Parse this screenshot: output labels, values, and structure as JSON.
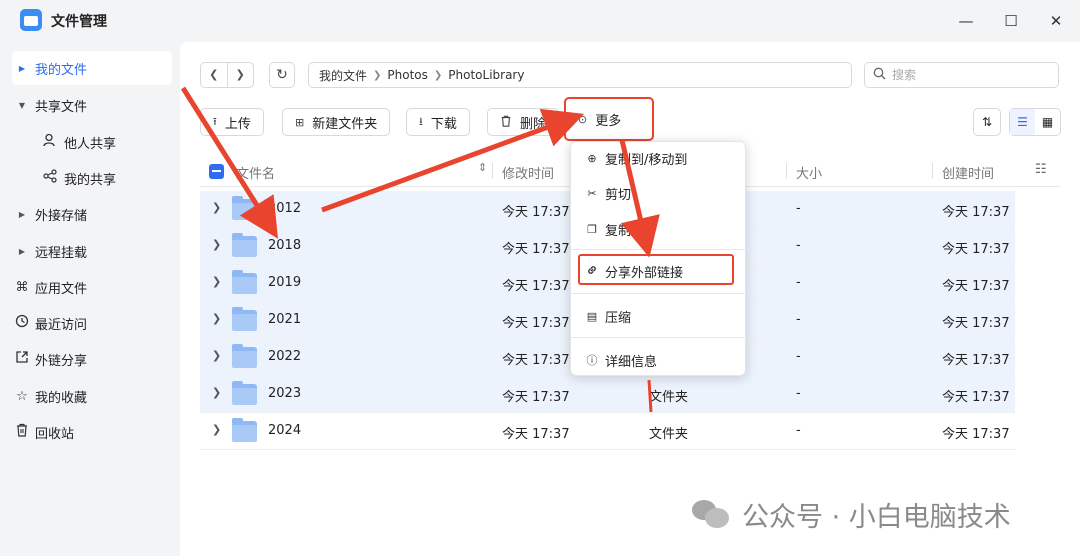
{
  "app": {
    "title": "文件管理",
    "window_controls": {
      "minimize": "—",
      "maximize": "☐",
      "close": "✕"
    }
  },
  "sidebar": {
    "items": [
      {
        "label": "我的文件",
        "icon": "caret-right-icon",
        "active": true
      },
      {
        "label": "共享文件",
        "icon": "caret-down-icon"
      },
      {
        "label": "他人共享",
        "icon": "user-icon",
        "sub": true
      },
      {
        "label": "我的共享",
        "icon": "share-icon",
        "sub": true
      },
      {
        "label": "外接存储",
        "icon": "caret-right-icon"
      },
      {
        "label": "远程挂载",
        "icon": "caret-right-icon"
      },
      {
        "label": "应用文件",
        "icon": "command-icon"
      },
      {
        "label": "最近访问",
        "icon": "clock-icon"
      },
      {
        "label": "外链分享",
        "icon": "external-link-icon"
      },
      {
        "label": "我的收藏",
        "icon": "star-icon"
      },
      {
        "label": "回收站",
        "icon": "trash-icon"
      }
    ]
  },
  "breadcrumb": [
    "我的文件",
    "Photos",
    "PhotoLibrary"
  ],
  "search": {
    "placeholder": "搜索"
  },
  "toolbar": {
    "upload": "上传",
    "new_folder": "新建文件夹",
    "download": "下载",
    "delete": "删除",
    "more": "更多"
  },
  "table": {
    "headers": {
      "name": "文件名",
      "modified": "修改时间",
      "size": "大小",
      "created": "创建时间"
    },
    "rows": [
      {
        "name": "2012",
        "modified": "今天 17:37",
        "type": "",
        "size": "-",
        "created": "今天 17:37",
        "selected": true
      },
      {
        "name": "2018",
        "modified": "今天 17:37",
        "type": "",
        "size": "-",
        "created": "今天 17:37",
        "selected": true
      },
      {
        "name": "2019",
        "modified": "今天 17:37",
        "type": "",
        "size": "-",
        "created": "今天 17:37",
        "selected": true
      },
      {
        "name": "2021",
        "modified": "今天 17:37",
        "type": "",
        "size": "-",
        "created": "今天 17:37",
        "selected": true
      },
      {
        "name": "2022",
        "modified": "今天 17:37",
        "type": "",
        "size": "-",
        "created": "今天 17:37",
        "selected": true
      },
      {
        "name": "2023",
        "modified": "今天 17:37",
        "type": "文件夹",
        "size": "-",
        "created": "今天 17:37",
        "selected": true
      },
      {
        "name": "2024",
        "modified": "今天 17:37",
        "type": "文件夹",
        "size": "-",
        "created": "今天 17:37",
        "selected": false
      }
    ]
  },
  "context_menu": {
    "items": [
      {
        "label": "复制到/移动到",
        "icon": "copy-move-icon"
      },
      {
        "label": "剪切",
        "icon": "scissors-icon"
      },
      {
        "label": "复制",
        "icon": "copy-icon"
      },
      {
        "label": "分享外部链接",
        "icon": "link-icon",
        "highlighted": true
      },
      {
        "label": "压缩",
        "icon": "archive-icon"
      },
      {
        "label": "详细信息",
        "icon": "info-icon"
      }
    ]
  },
  "watermark": {
    "text": "公众号 · 小白电脑技术"
  },
  "colors": {
    "accent": "#2f6cf0",
    "annotation": "#e8442e",
    "selected_row": "#edf3fd"
  }
}
